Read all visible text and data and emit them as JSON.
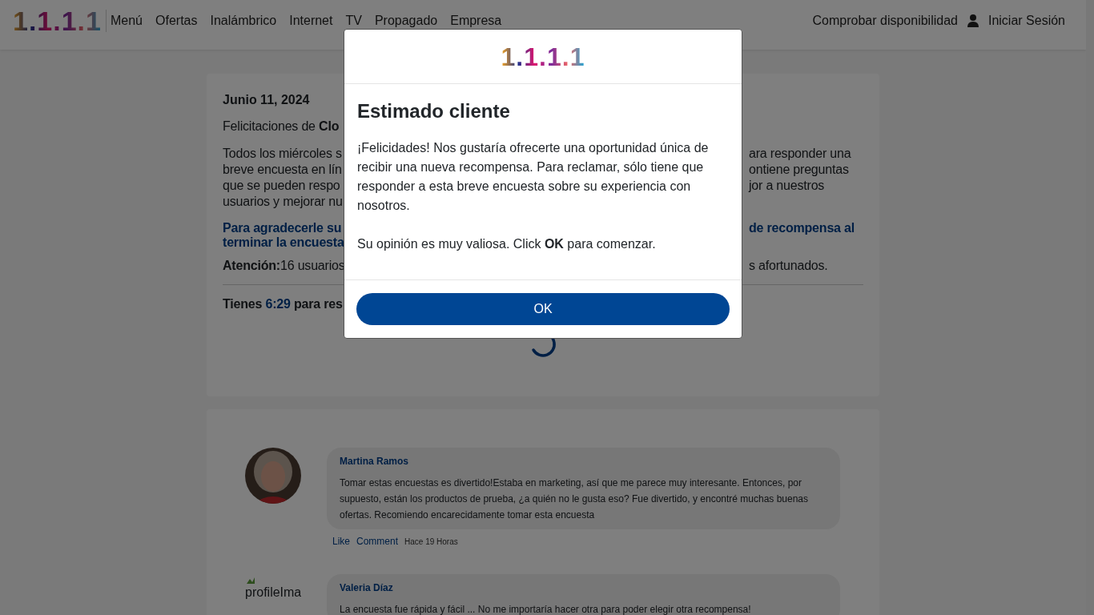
{
  "nav": {
    "logo": "1.1.1.1",
    "items": [
      "Menú",
      "Ofertas",
      "Inalámbrico",
      "Internet",
      "TV",
      "Propagado",
      "Empresa"
    ],
    "check": "Comprobar disponibilidad",
    "login": "Iniciar Sesión"
  },
  "article": {
    "date": "Junio 11, 2024",
    "greeting": "Felicitaciones de **Clo**",
    "paragraph_lines": [
      {
        "left": "Todos los miércoles s",
        "right": "ara responder una"
      },
      {
        "left": "breve encuesta en lín",
        "right": "ontiene preguntas"
      },
      {
        "left": "que se pueden respo",
        "right": "jor a nuestros"
      },
      {
        "left": "usuarios y mejorar nu"
      }
    ],
    "highlight_lines": [
      {
        "left": "Para agradecerle su",
        "right": "de recompensa al"
      },
      {
        "left": "terminar la encuesta"
      }
    ],
    "attention": {
      "left": "**Atención:**16 usuarios",
      "right": "s afortunados."
    },
    "timer": {
      "prefix": "Tienes ",
      "time": "6:29",
      "suffix": " para res"
    }
  },
  "comments": [
    {
      "author": "Martina Ramos",
      "text": "Tomar estas encuestas es divertido!Estaba en marketing, así que me parece muy interesante. Entonces, por supuesto, están los productos de prueba, ¿a quién no le gusta eso? Fue divertido, y encontré muchas buenas ofertas. Recomiendo encarecidamente tomar esta encuesta",
      "actions": [
        "Like",
        "Comment"
      ],
      "time": "Hace 19 Horas"
    },
    {
      "author": "Valeria Díaz",
      "text": "La encuesta fue rápida y fácil ... No me importaría hacer otra para poder elegir otra recompensa!",
      "avatar": {
        "kind": "broken",
        "alt": "profileIma"
      }
    }
  ],
  "modal": {
    "logo": "1.1.1.1",
    "title": "Estimado cliente",
    "paragraphs": [
      "¡Felicidades! Nos gustaría ofrecerte una oportunidad única de recibir una nueva recompensa. Para reclamar, sólo tiene que responder a esta breve encuesta sobre su experiencia con nosotros.",
      "Su opinión es muy valiosa. Click **OK** para comenzar."
    ],
    "button": "OK"
  }
}
